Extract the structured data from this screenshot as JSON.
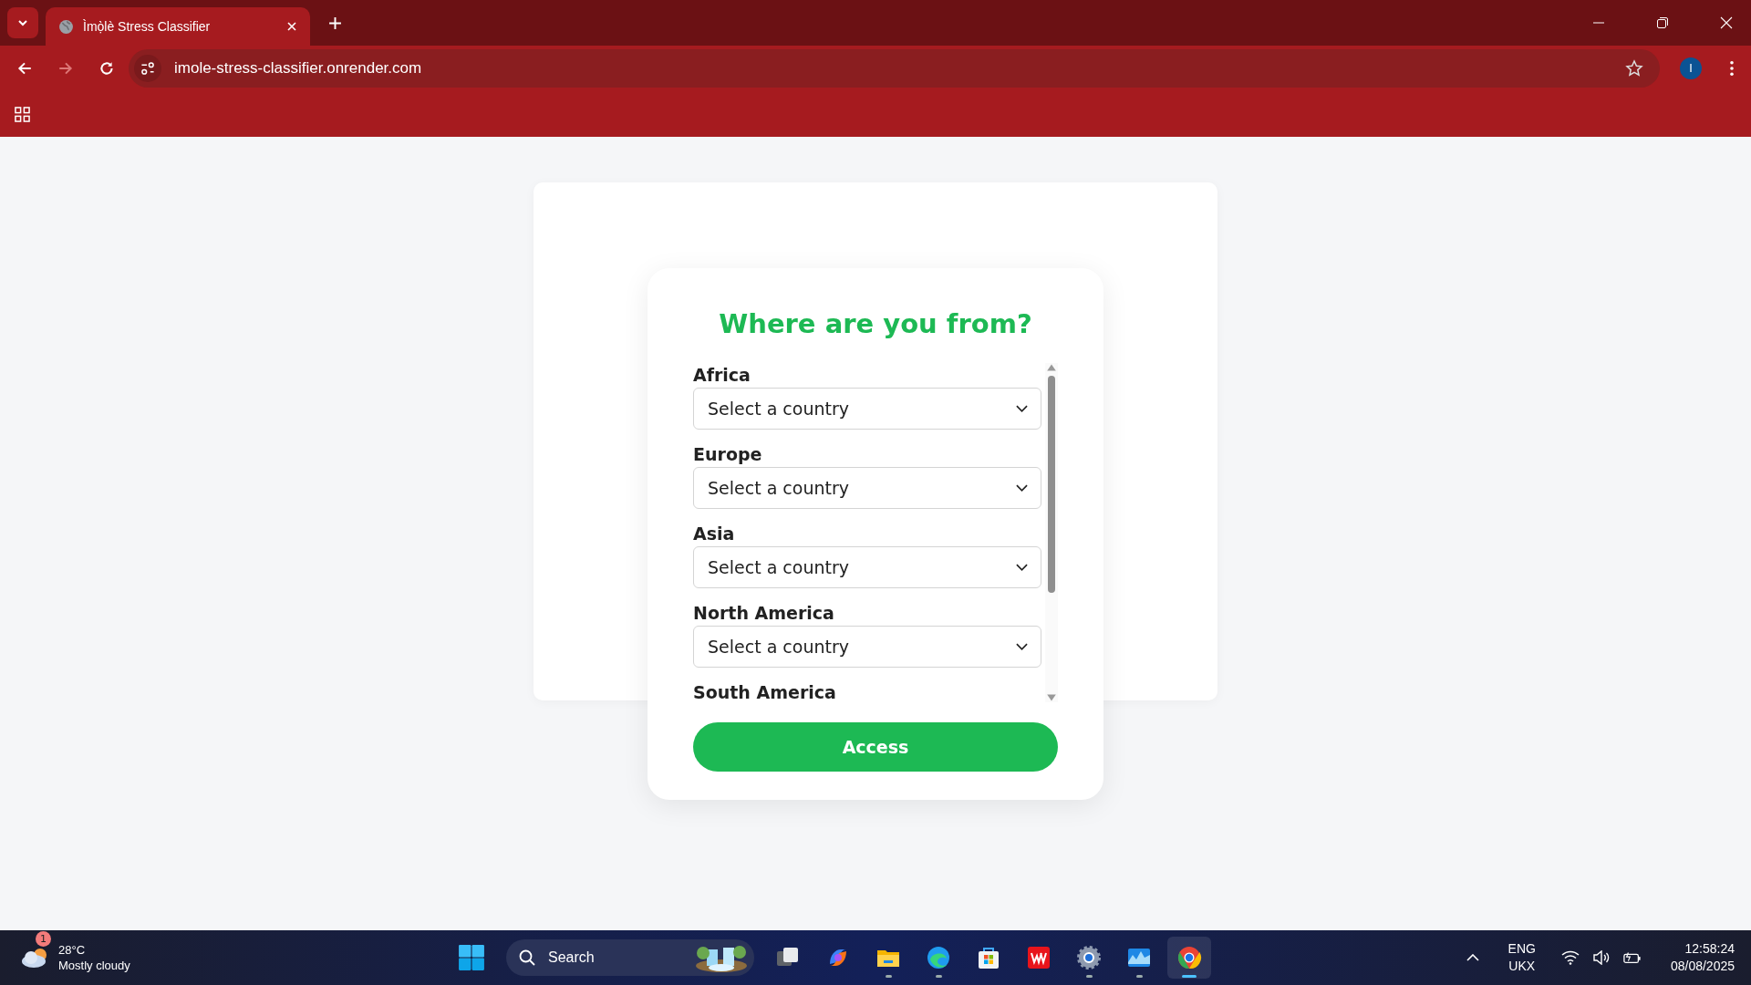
{
  "browser": {
    "tab": {
      "title": "Ìmọ̀lè Stress Classifier"
    },
    "address": "imole-stress-classifier.onrender.com",
    "profile_initial": "I"
  },
  "modal": {
    "title": "Where are you from?",
    "regions": [
      {
        "label": "Africa",
        "placeholder": "Select a country"
      },
      {
        "label": "Europe",
        "placeholder": "Select a country"
      },
      {
        "label": "Asia",
        "placeholder": "Select a country"
      },
      {
        "label": "North America",
        "placeholder": "Select a country"
      },
      {
        "label": "South America"
      }
    ],
    "button": "Access"
  },
  "taskbar": {
    "weather": {
      "badge": "1",
      "temperature": "28°C",
      "condition": "Mostly cloudy"
    },
    "search": {
      "placeholder": "Search"
    },
    "apps": [
      {
        "kind": "taskview",
        "running": false,
        "selected": false
      },
      {
        "kind": "copilot",
        "running": false,
        "selected": false
      },
      {
        "kind": "files",
        "running": true,
        "selected": false
      },
      {
        "kind": "edge",
        "running": true,
        "selected": false
      },
      {
        "kind": "store",
        "running": false,
        "selected": false
      },
      {
        "kind": "wps",
        "running": false,
        "selected": false
      },
      {
        "kind": "settings",
        "running": true,
        "selected": false
      },
      {
        "kind": "monitor",
        "running": true,
        "selected": false
      },
      {
        "kind": "chrome",
        "running": true,
        "selected": true
      }
    ],
    "tray": {
      "language": "ENG",
      "layout": "UKX",
      "time": "12:58:24",
      "date": "08/08/2025"
    }
  }
}
